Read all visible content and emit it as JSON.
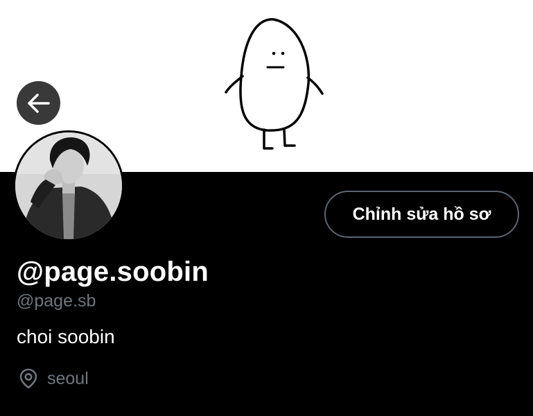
{
  "header": {
    "back_icon": "arrow-left-icon",
    "banner_image": "doodle-character"
  },
  "profile": {
    "display_name": "@page.soobin",
    "handle": "@page.sb",
    "bio": "choi soobin",
    "location": "seoul",
    "location_icon": "map-pin-icon",
    "edit_button_label": "Chỉnh sửa hồ sơ"
  },
  "colors": {
    "background": "#000000",
    "banner": "#ffffff",
    "secondary_text": "#6e767d",
    "button_border": "#5b6670"
  }
}
